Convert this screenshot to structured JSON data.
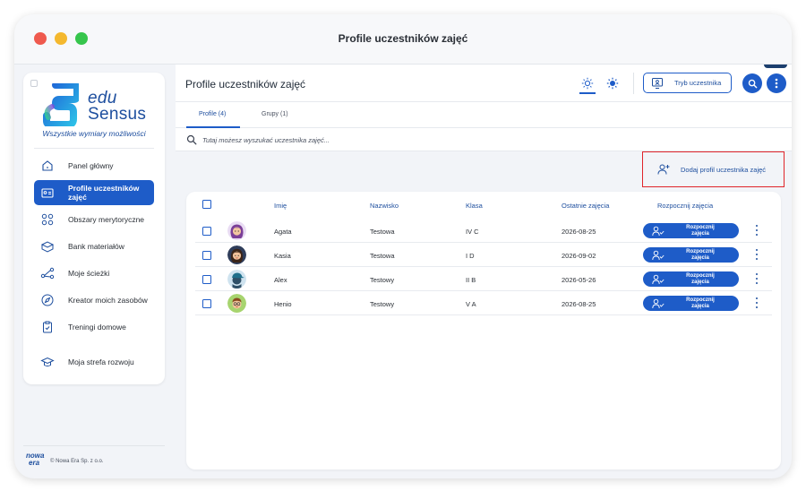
{
  "window": {
    "title": "Profile uczestników zajęć"
  },
  "sidebar": {
    "logo_line1": "edu",
    "logo_line2": "Sensus",
    "tagline": "Wszystkie wymiary możliwości",
    "items": [
      {
        "label": "Panel główny",
        "icon": "home-icon",
        "active": false
      },
      {
        "label": "Profile uczestników zajęć",
        "icon": "id-card-icon",
        "active": true
      },
      {
        "label": "Obszary merytoryczne",
        "icon": "grid-icon",
        "active": false
      },
      {
        "label": "Bank materiałów",
        "icon": "box-icon",
        "active": false
      },
      {
        "label": "Moje ścieżki",
        "icon": "path-icon",
        "active": false
      },
      {
        "label": "Kreator moich zasobów",
        "icon": "compass-icon",
        "active": false
      },
      {
        "label": "Treningi domowe",
        "icon": "clipboard-icon",
        "active": false
      },
      {
        "label": "Moja strefa rozwoju",
        "icon": "graduation-cap-icon",
        "active": false
      }
    ],
    "footer_logo_line1": "nowa",
    "footer_logo_line2": "era",
    "footer_text": "© Nowa Era Sp. z o.o."
  },
  "header": {
    "title": "Profile uczestników zajęć",
    "mode_button": "Tryb uczestnika"
  },
  "tabs": [
    {
      "label": "Profile (4)",
      "active": true
    },
    {
      "label": "Grupy (1)",
      "active": false
    }
  ],
  "search": {
    "placeholder": "Tutaj możesz wyszukać uczestnika zajęć..."
  },
  "add_button": {
    "label": "Dodaj profil uczestnika zajęć"
  },
  "table": {
    "columns": [
      "Imię",
      "Nazwisko",
      "Klasa",
      "Ostatnie zajęcia",
      "Rozpocznij zajęcia"
    ],
    "start_label": "Rozpocznij zajęcia",
    "rows": [
      {
        "first": "Agata",
        "last": "Testowa",
        "class": "IV C",
        "last_session": "2026-08-25",
        "avatar": "girl-purple-hair-avatar"
      },
      {
        "first": "Kasia",
        "last": "Testowa",
        "class": "I D",
        "last_session": "2026-09-02",
        "avatar": "girl-dark-hair-avatar"
      },
      {
        "first": "Alex",
        "last": "Testowy",
        "class": "II B",
        "last_session": "2026-05-26",
        "avatar": "boy-cap-avatar"
      },
      {
        "first": "Henio",
        "last": "Testowy",
        "class": "V A",
        "last_session": "2026-08-25",
        "avatar": "boy-glasses-avatar"
      }
    ]
  },
  "colors": {
    "accent": "#1e5cc8",
    "brand": "#1d4e9e",
    "highlight": "#e0242a"
  }
}
